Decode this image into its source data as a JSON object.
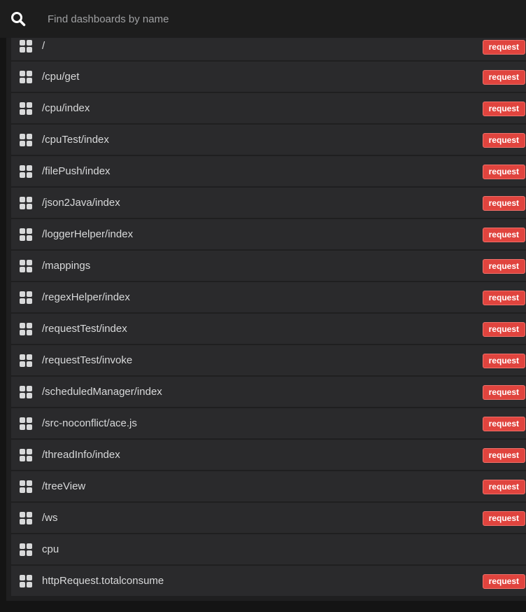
{
  "search": {
    "placeholder": "Find dashboards by name",
    "icon": "search-icon"
  },
  "colors": {
    "tag_bg": "#e0443e",
    "row_bg": "#2a2a2c",
    "text": "#d8d9da"
  },
  "dashboards": [
    {
      "title": "/",
      "tag": "request"
    },
    {
      "title": "/cpu/get",
      "tag": "request"
    },
    {
      "title": "/cpu/index",
      "tag": "request"
    },
    {
      "title": "/cpuTest/index",
      "tag": "request"
    },
    {
      "title": "/filePush/index",
      "tag": "request"
    },
    {
      "title": "/json2Java/index",
      "tag": "request"
    },
    {
      "title": "/loggerHelper/index",
      "tag": "request"
    },
    {
      "title": "/mappings",
      "tag": "request"
    },
    {
      "title": "/regexHelper/index",
      "tag": "request"
    },
    {
      "title": "/requestTest/index",
      "tag": "request"
    },
    {
      "title": "/requestTest/invoke",
      "tag": "request"
    },
    {
      "title": "/scheduledManager/index",
      "tag": "request"
    },
    {
      "title": "/src-noconflict/ace.js",
      "tag": "request"
    },
    {
      "title": "/threadInfo/index",
      "tag": "request"
    },
    {
      "title": "/treeView",
      "tag": "request"
    },
    {
      "title": "/ws",
      "tag": "request"
    },
    {
      "title": "cpu",
      "tag": ""
    },
    {
      "title": "httpRequest.totalconsume",
      "tag": "request"
    }
  ]
}
